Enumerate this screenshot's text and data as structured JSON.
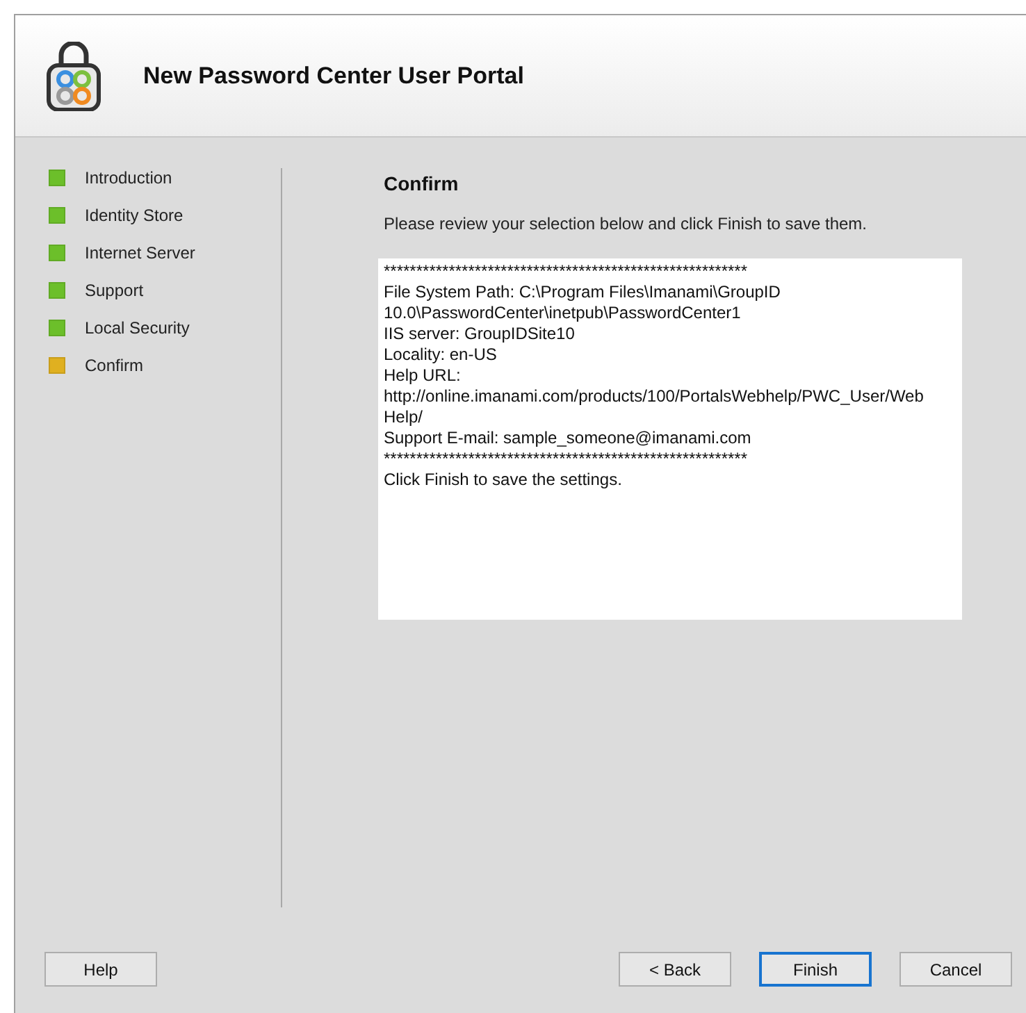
{
  "header": {
    "title": "New Password Center User Portal"
  },
  "steps": [
    {
      "label": "Introduction",
      "color": "#6cbf2a"
    },
    {
      "label": "Identity Store",
      "color": "#6cbf2a"
    },
    {
      "label": "Internet Server",
      "color": "#6cbf2a"
    },
    {
      "label": "Support",
      "color": "#6cbf2a"
    },
    {
      "label": "Local Security",
      "color": "#6cbf2a"
    },
    {
      "label": "Confirm",
      "color": "#e0b020"
    }
  ],
  "page": {
    "heading": "Confirm",
    "instruction": "Please review your selection below and click Finish to save them.",
    "summary_lines": [
      "********************************************************",
      "File System Path: C:\\Program Files\\Imanami\\GroupID",
      "10.0\\PasswordCenter\\inetpub\\PasswordCenter1",
      "IIS server: GroupIDSite10",
      "Locality: en-US",
      "Help URL:",
      "http://online.imanami.com/products/100/PortalsWebhelp/PWC_User/Web",
      "Help/",
      "Support E-mail: sample_someone@imanami.com",
      "********************************************************",
      "Click Finish to save the settings."
    ]
  },
  "buttons": [
    {
      "label": "Help",
      "kind": "normal"
    },
    {
      "label": "< Back",
      "kind": "normal"
    },
    {
      "label": "Finish",
      "kind": "default"
    },
    {
      "label": "Cancel",
      "kind": "normal"
    }
  ]
}
